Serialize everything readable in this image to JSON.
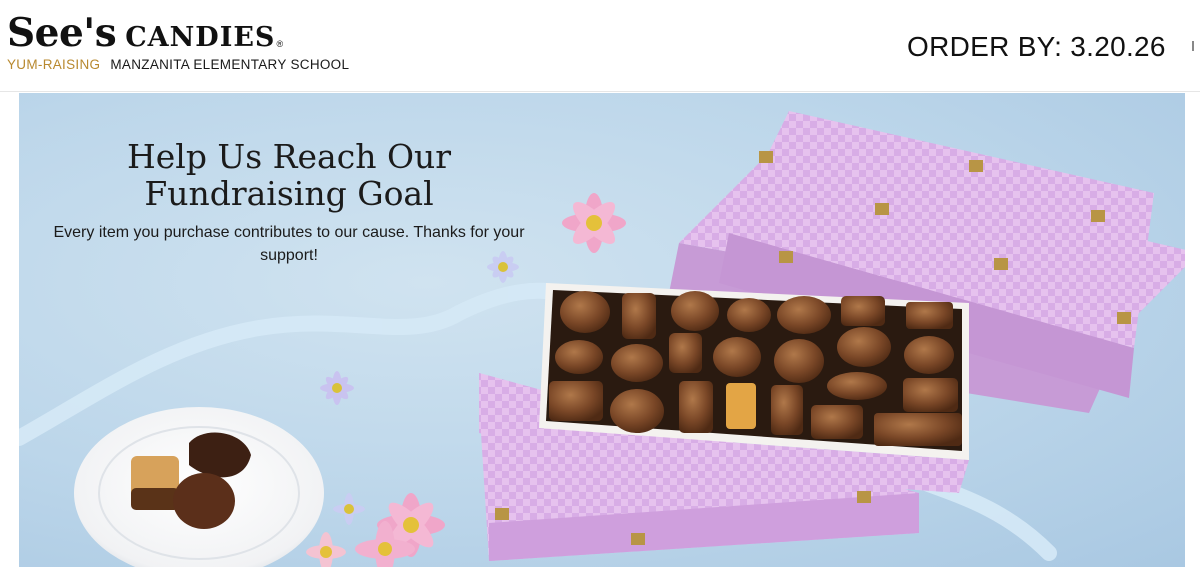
{
  "brand": {
    "name": "See's",
    "name_suffix": "CANDIES",
    "registered": "®",
    "program": "YUM-RAISING",
    "school": "MANZANITA ELEMENTARY SCHOOL"
  },
  "order": {
    "label": "ORDER BY: 3.20.26"
  },
  "hero": {
    "headline": "Help Us Reach Our\nFundraising Goal",
    "subtext": "Every item you purchase contributes to our cause. Thanks for your support!"
  },
  "colors": {
    "gold": "#b8892f",
    "hero_blue": "#bcd6ea",
    "box_lavender": "#d9aee6",
    "chocolate": "#6b3e20"
  }
}
